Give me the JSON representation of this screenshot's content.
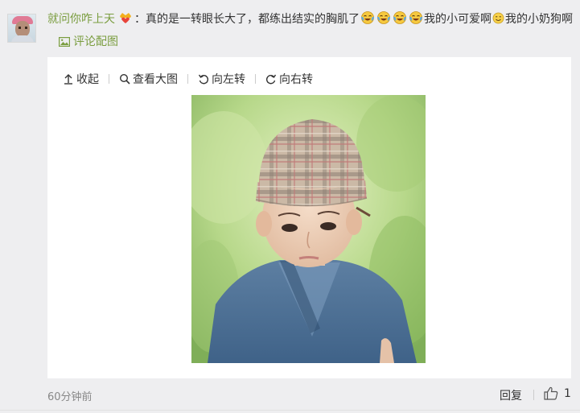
{
  "comment": {
    "avatar_icon": "user-avatar",
    "username": "就问你咋上天",
    "badge_icon": "vip-crown-heart-icon",
    "text_part1": "：真的是一转眼长大了，都练出结实的胸肌了",
    "emoji_icon": "laugh-cry-emoji",
    "emoji_count": 4,
    "text_part2": "我的小可爱啊",
    "smile_icon": "smile-emoji",
    "text_part3": "我的小奶狗啊",
    "pic_link_label": "评论配图",
    "pic_link_icon": "image-icon"
  },
  "toolbar": {
    "collapse_label": "收起",
    "view_large_label": "查看大图",
    "rotate_left_label": "向左转",
    "rotate_right_label": "向右转"
  },
  "footer": {
    "time": "60分钟前",
    "reply_label": "回复",
    "like_count": "1"
  },
  "colors": {
    "link_green": "#7a9d3f",
    "text": "#333333",
    "muted": "#888888",
    "background": "#eeeef0",
    "card": "#ffffff"
  }
}
